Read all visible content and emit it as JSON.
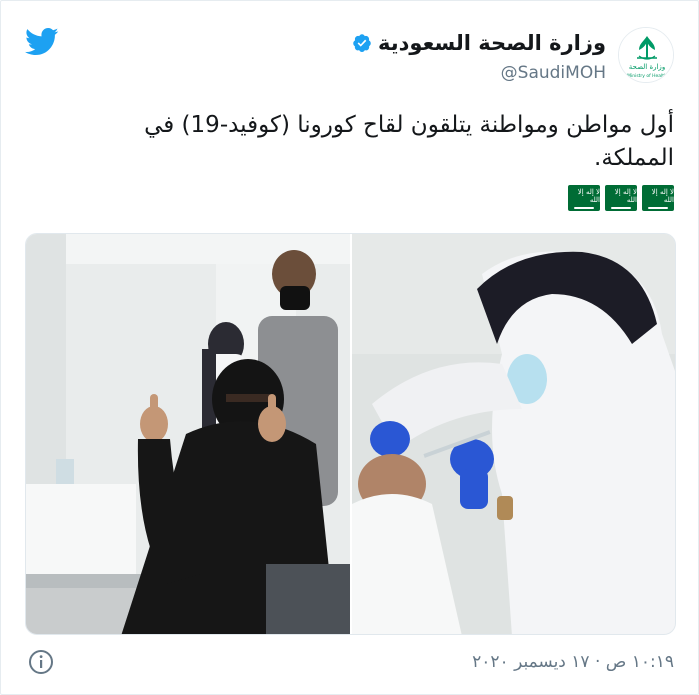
{
  "header": {
    "display_name": "وزارة الصحة السعودية",
    "handle": "@SaudiMOH",
    "avatar_label_ar": "وزارة الصحة",
    "avatar_label_en": "Ministry of Health"
  },
  "tweet": {
    "text": "أول مواطن ومواطنة يتلقون لقاح كورونا (كوفيد-19) في المملكة.",
    "flag_count": 3,
    "flag_script": "لا إله إلا الله"
  },
  "footer": {
    "timestamp": "١٠:١٩ ص · ١٧ ديسمبر ٢٠٢٠"
  },
  "icons": {
    "twitter": "twitter-bird-icon",
    "verified": "verified-badge-icon",
    "info": "info-icon",
    "flag": "saudi-flag-icon"
  },
  "colors": {
    "twitter_blue": "#1da1f2",
    "text_primary": "#14171a",
    "text_secondary": "#657786",
    "moh_green": "#009a66",
    "flag_green": "#006c35"
  }
}
